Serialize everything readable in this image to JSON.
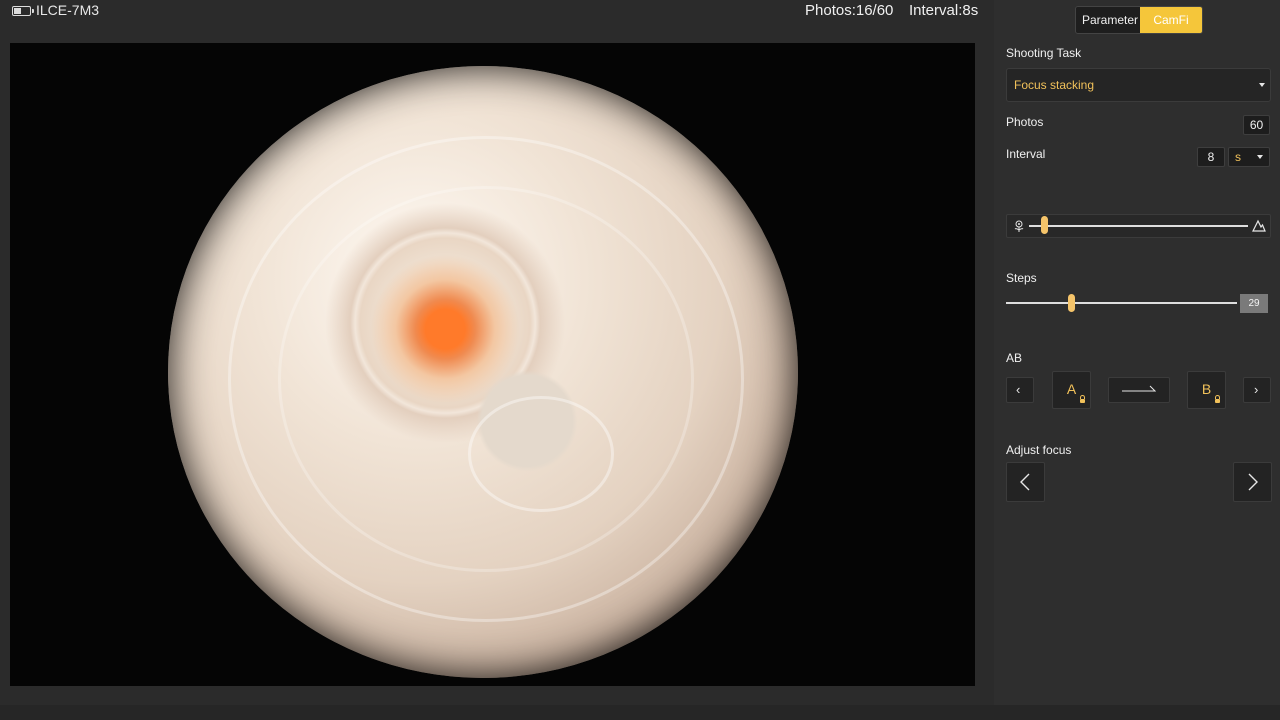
{
  "header": {
    "camera_name": "ILCE-7M3",
    "photos_status": "Photos:16/60",
    "interval_status": "Interval:8s",
    "battery_level": 0.45
  },
  "panel": {
    "tabs": [
      {
        "label": "Parameter",
        "active": false
      },
      {
        "label": "CamFi ZF",
        "active": true
      }
    ],
    "accent_color": "#f5c63a",
    "shooting_task": {
      "label": "Shooting Task",
      "value": "Focus stacking"
    },
    "photos": {
      "label": "Photos",
      "value": "60"
    },
    "interval": {
      "label": "Interval",
      "value": "8",
      "unit": "s"
    },
    "focus_slider": {
      "near_icon": "flower-icon",
      "far_icon": "mountain-icon",
      "position": 0.07
    },
    "steps": {
      "label": "Steps",
      "value": "29",
      "position": 0.28
    },
    "ab": {
      "label": "AB",
      "a_label": "A",
      "b_label": "B"
    },
    "adjust_focus": {
      "label": "Adjust focus"
    }
  }
}
